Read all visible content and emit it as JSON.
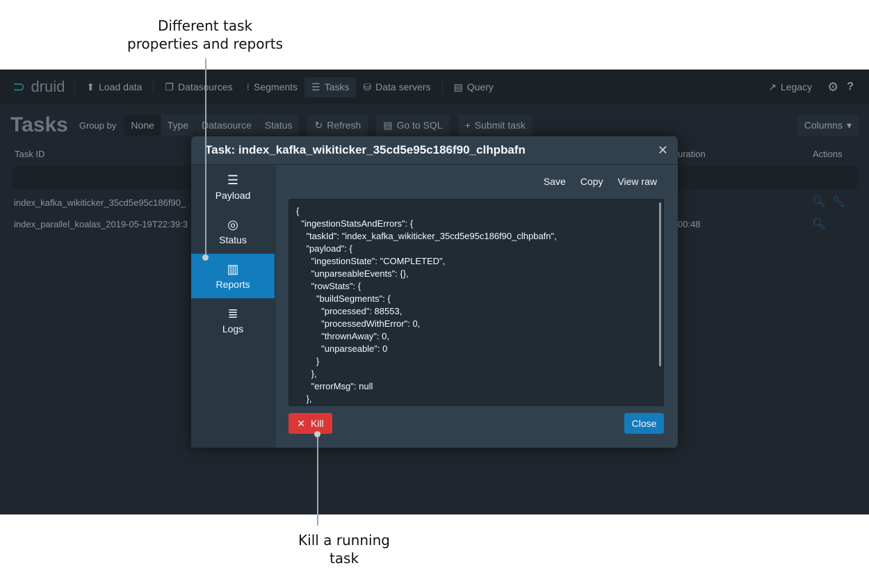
{
  "annotations": {
    "top": "Different task\nproperties and reports",
    "bottom": "Kill a running\ntask"
  },
  "nav": {
    "logo": "druid",
    "items": [
      "Load data",
      "Datasources",
      "Segments",
      "Tasks",
      "Data servers",
      "Query"
    ],
    "active": "Tasks",
    "legacy": "Legacy"
  },
  "toolbar": {
    "title": "Tasks",
    "group_by": "Group by",
    "groups": [
      "None",
      "Type",
      "Datasource",
      "Status"
    ],
    "refresh": "Refresh",
    "go_sql": "Go to SQL",
    "submit": "Submit task",
    "columns": "Columns"
  },
  "table": {
    "headers": {
      "task_id": "Task ID",
      "duration": "uration",
      "actions": "Actions"
    },
    "rows": [
      {
        "id": "index_kafka_wikiticker_35cd5e95c186f90_",
        "duration": ""
      },
      {
        "id": "index_parallel_koalas_2019-05-19T22:39:3",
        "duration": "00:48"
      }
    ]
  },
  "modal": {
    "title": "Task: index_kafka_wikiticker_35cd5e95c186f90_clhpbafn",
    "tabs": [
      "Payload",
      "Status",
      "Reports",
      "Logs"
    ],
    "active_tab": "Reports",
    "actions": [
      "Save",
      "Copy",
      "View raw"
    ],
    "code": "{\n  \"ingestionStatsAndErrors\": {\n    \"taskId\": \"index_kafka_wikiticker_35cd5e95c186f90_clhpbafn\",\n    \"payload\": {\n      \"ingestionState\": \"COMPLETED\",\n      \"unparseableEvents\": {},\n      \"rowStats\": {\n        \"buildSegments\": {\n          \"processed\": 88553,\n          \"processedWithError\": 0,\n          \"thrownAway\": 0,\n          \"unparseable\": 0\n        }\n      },\n      \"errorMsg\": null\n    },",
    "kill": "Kill",
    "close": "Close"
  },
  "colors": {
    "accent": "#137cbd",
    "danger": "#db3737"
  }
}
